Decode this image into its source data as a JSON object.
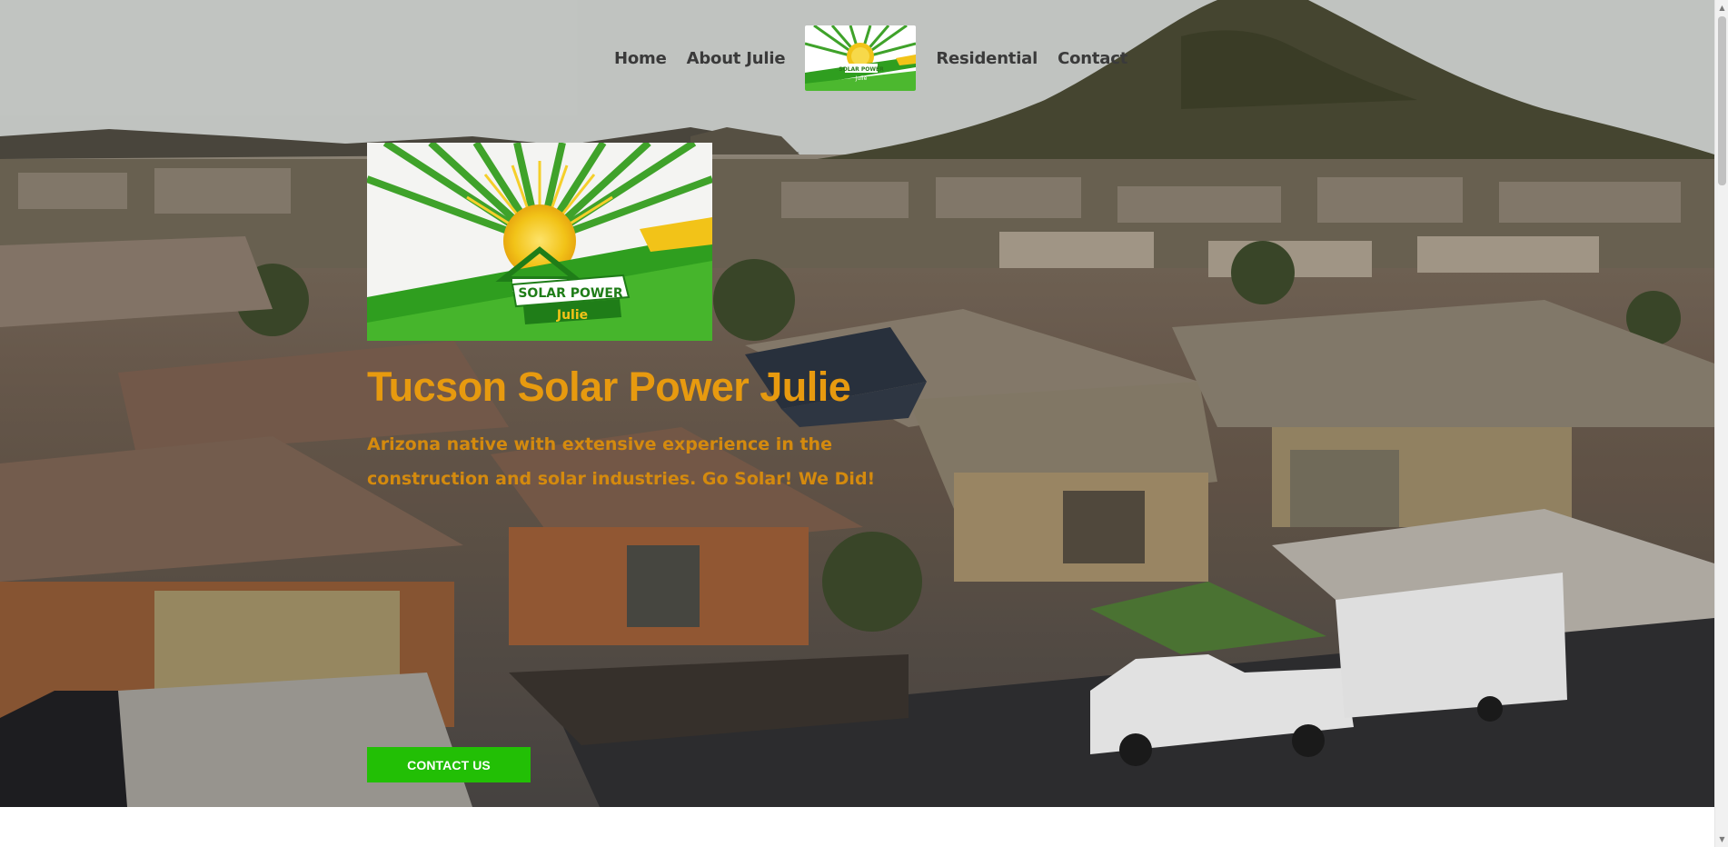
{
  "nav": {
    "items": [
      {
        "label": "Home"
      },
      {
        "label": "About Julie"
      },
      {
        "label": "Residential"
      },
      {
        "label": "Contact"
      }
    ],
    "logo_text_top": "SOLAR POWER",
    "logo_text_bottom": "Julie"
  },
  "hero": {
    "logo_text_top": "SOLAR POWER",
    "logo_text_bottom": "Julie",
    "title": "Tucson Solar Power Julie",
    "subtitle": "Arizona native with extensive experience in the construction and solar industries.  Go Solar!  We Did!",
    "cta_label": "CONTACT US"
  },
  "colors": {
    "title": "#e79a0f",
    "subtitle": "#d48a0e",
    "cta_bg": "#22bf05",
    "logo_green": "#2f9e1f",
    "logo_yellow": "#f2c318"
  },
  "icons": {
    "scroll_up": "chevron-up-icon",
    "scroll_down": "chevron-down-icon"
  }
}
